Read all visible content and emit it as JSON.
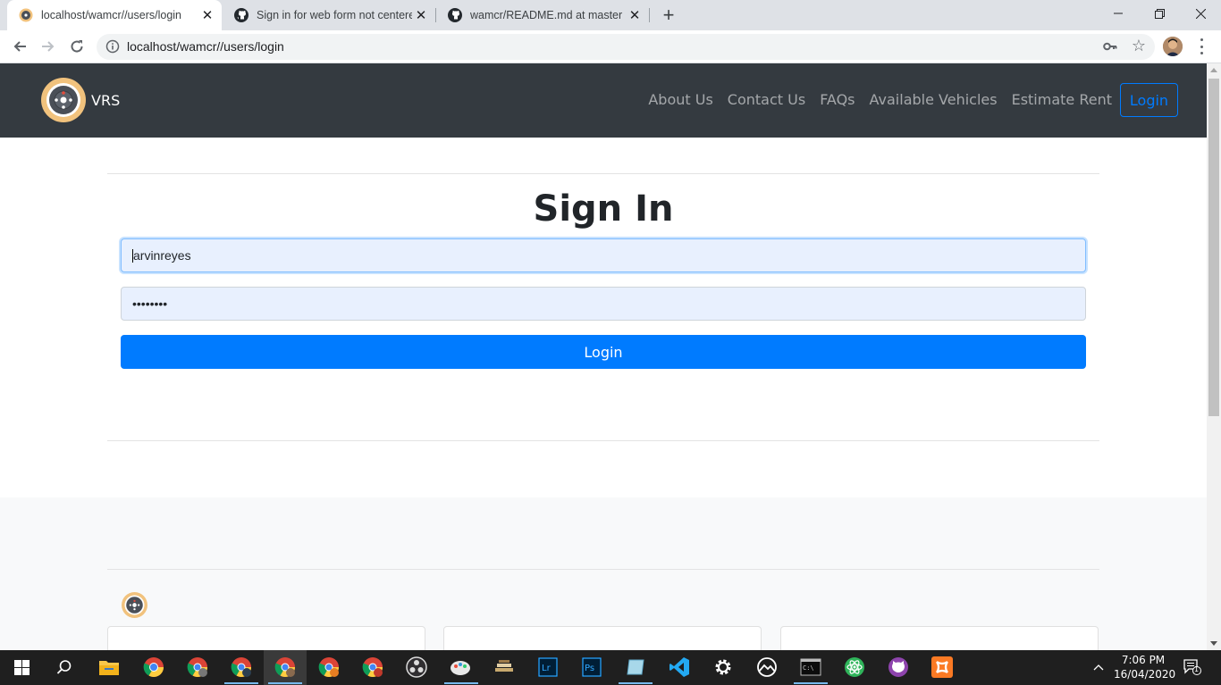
{
  "browser": {
    "tabs": [
      {
        "title": "localhost/wamcr//users/login",
        "icon": "vrs-favicon-icon"
      },
      {
        "title": "Sign in for web form not centered",
        "icon": "github-icon"
      },
      {
        "title": "wamcr/README.md at master · jo",
        "icon": "github-icon"
      }
    ],
    "new_tab": "+",
    "url": "localhost/wamcr//users/login",
    "window_controls": {
      "minimize": "—",
      "maximize": "❐",
      "close": "✕"
    }
  },
  "navbar": {
    "brand": "VRS",
    "links": [
      "About Us",
      "Contact Us",
      "FAQs",
      "Available Vehicles",
      "Estimate Rent"
    ],
    "login": "Login"
  },
  "form": {
    "heading": "Sign In",
    "username": "arvinreyes",
    "password_mask": "••••••••",
    "submit": "Login"
  },
  "colors": {
    "navbar_bg": "#343a40",
    "primary": "#007bff",
    "autofill_bg": "#e8f0fe",
    "footer_bg": "#f8f9fa"
  },
  "taskbar": {
    "time": "7:06 PM",
    "date": "16/04/2020",
    "notification_count": "1"
  }
}
